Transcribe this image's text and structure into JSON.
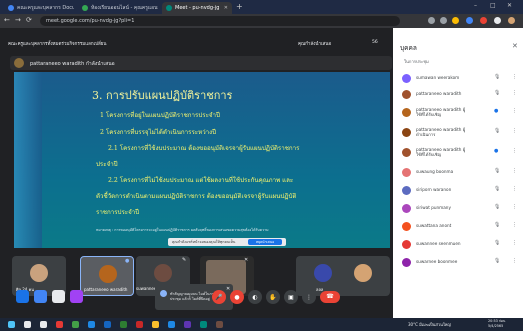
{
  "browser": {
    "tabs": [
      {
        "label": "คณะครูและบุคลากร Document Center",
        "active": false
      },
      {
        "label": "ห้องเรียนออนไลน์ - คุณครูแอนนิสา",
        "active": false
      },
      {
        "label": "Meet - pu-nvdg-jg",
        "active": true
      }
    ],
    "new_tab": "+",
    "window_controls": [
      "–",
      "□",
      "✕"
    ],
    "nav": [
      "←",
      "→",
      "⟳"
    ],
    "url": "meet.google.com/pu-nvdg-jg?pli=1"
  },
  "meet": {
    "header_title": "คณะครูและบุคลากรทั้งหมดร่วมกิจกรรมแลกเปลี่ยน",
    "header_status": "คุณกำลังนำเสนอ",
    "header_count": "56",
    "presenter_name": "pattaraneeo waradith กำลังนำเสนอ",
    "slide": {
      "title": "3. การปรับแผนปฏิบัติราชการ",
      "bullets": [
        "1 โครงการที่อยู่ในแผนปฏิบัติราชการประจำปี",
        "2 โครงการที่บรรจุไม่ได้ดำเนินการระหว่างปี",
        "2.1 โครงการที่ใช้งบประมาณ ต้องขออนุมัติเจรจาผู้รับแผนปฏิบัติราชการ",
        "ประจำปี",
        "2.2 โครงการที่ไม่ใช้งบประมาณ  แต่ใช้ผลงานที่ใช้ประกันคุณภาพ และ",
        "ตัวชี้วัดการดำเนินตามแผนปฏิบัติราชการ ต้องขออนุมัติเจรจาผู้รับแผนปฏิบัติ",
        "ราชการประจำปี"
      ],
      "footnote": "หมายเหตุ : การขออนุมัติโครงการจะอยู่ในแผนปฏิบัติราชการ ผลสัมฤทธิ์ของการเสนอขอความสุขต้องได้รับความ",
      "share_notice": "คุณกำลังแชร์หน้าจอของคุณให้ทุกคนเห็น",
      "share_button": "หยุดนำเสนอ"
    },
    "tiles": [
      {
        "name": "ศิล 24 คน",
        "kind": "avatar"
      },
      {
        "name": "pattaraneeo waradith",
        "kind": "avatar"
      },
      {
        "name": "suwannee",
        "kind": "avatar"
      },
      {
        "name": "",
        "kind": "video"
      },
      {
        "name": "ลลล",
        "kind": "avatar"
      },
      {
        "name": "",
        "kind": "avatar"
      }
    ],
    "tooltip": "ทำสัญญาณมุมบน ไมค์ในการประชุม แล้วก็ ไมค์ที่ปิดอยู่",
    "controls": {
      "mic_icon": "mic-off-icon",
      "end_icon": "call-end-icon",
      "right_icons": [
        "info-icon",
        "people-icon",
        "chat-icon",
        "activities-icon"
      ],
      "participant_badge": "56"
    },
    "people_panel": {
      "title": "บุคคล",
      "section": "ในการประชุม",
      "close": "✕",
      "people": [
        {
          "name": "sumawan weerakom",
          "color": "#7b61ff"
        },
        {
          "name": "pattaraneeo waradith",
          "color": "#a0522d"
        },
        {
          "name": "pattaraneeo waradith ผู้ใช้ที่ได้รับเชิญ",
          "color": "#b5651d"
        },
        {
          "name": "pattaraneeo waradith ผู้ดำเนินการ",
          "color": "#8b4513"
        },
        {
          "name": "pattaraneeo waradith ผู้ใช้ที่ได้รับเชิญ",
          "color": "#a0522d"
        },
        {
          "name": "suwaung boonma",
          "color": "#e57373"
        },
        {
          "name": "siriporn waranon",
          "color": "#5c6bc0"
        },
        {
          "name": "siriwat punmany",
          "color": "#ab47bc"
        },
        {
          "name": "suwattana anont",
          "color": "#f4511e"
        },
        {
          "name": "suwannee seenmuen",
          "color": "#e53935"
        },
        {
          "name": "suwarnee boonmee",
          "color": "#8e24aa"
        }
      ]
    }
  },
  "taskbar": {
    "weather": "30°C มีเมฆเป็นส่วนใหญ่",
    "time": "20:53 ก่อน",
    "date": "5/4/2565"
  },
  "colors": {
    "slide_bg": "#0c6f8f",
    "slide_text": "#f3f36e",
    "end_call": "#ea4335",
    "accent": "#1a73e8"
  }
}
